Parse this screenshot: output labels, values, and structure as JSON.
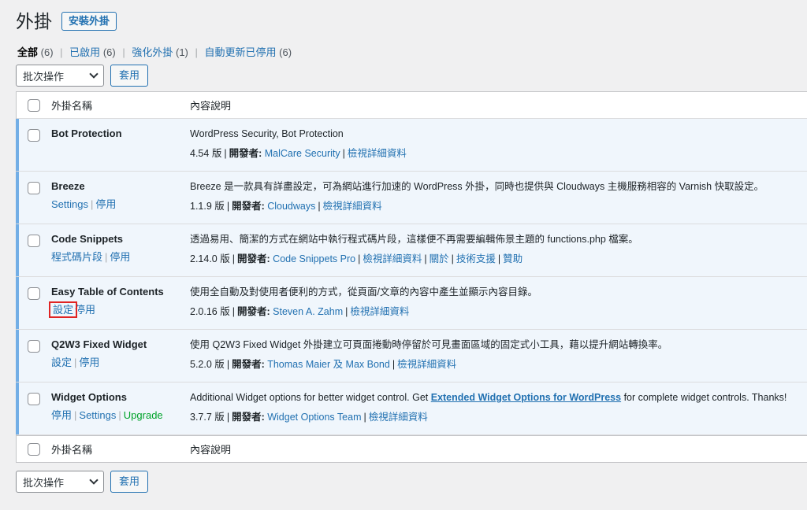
{
  "header": {
    "title": "外掛",
    "add_new": "安裝外掛"
  },
  "filters": [
    {
      "label": "全部",
      "count": "(6)",
      "current": true
    },
    {
      "label": "已啟用",
      "count": "(6)"
    },
    {
      "label": "強化外掛",
      "count": "(1)"
    },
    {
      "label": "自動更新已停用",
      "count": "(6)"
    }
  ],
  "bulk": {
    "select_value": "批次操作",
    "apply": "套用"
  },
  "columns": {
    "name": "外掛名稱",
    "desc": "內容說明"
  },
  "meta_labels": {
    "version_suffix": "版",
    "author_label": "開發者:"
  },
  "plugins": [
    {
      "name": "Bot Protection",
      "actions": [],
      "description": "WordPress Security, Bot Protection",
      "version": "4.54",
      "author": "MalCare Security",
      "links": [
        "檢視詳細資料"
      ]
    },
    {
      "name": "Breeze",
      "actions": [
        "Settings",
        "停用"
      ],
      "description": "Breeze 是一款具有詳盡設定，可為網站進行加速的 WordPress 外掛，同時也提供與 Cloudways 主機服務相容的 Varnish 快取設定。",
      "version": "1.1.9",
      "author": "Cloudways",
      "links": [
        "檢視詳細資料"
      ]
    },
    {
      "name": "Code Snippets",
      "actions": [
        "程式碼片段",
        "停用"
      ],
      "description": "透過易用、簡潔的方式在網站中執行程式碼片段，這樣便不再需要編輯佈景主題的 functions.php 檔案。",
      "version": "2.14.0",
      "author": "Code Snippets Pro",
      "links": [
        "檢視詳細資料",
        "關於",
        "技術支援",
        "贊助"
      ]
    },
    {
      "name": "Easy Table of Contents",
      "actions": [
        "設定",
        "停用"
      ],
      "description": "使用全自動及對使用者便利的方式，從頁面/文章的內容中產生並顯示內容目錄。",
      "version": "2.0.16",
      "author": "Steven A. Zahm",
      "links": [
        "檢視詳細資料"
      ]
    },
    {
      "name": "Q2W3 Fixed Widget",
      "actions": [
        "設定",
        "停用"
      ],
      "description": "使用 Q2W3 Fixed Widget 外掛建立可頁面捲動時停留於可見畫面區域的固定式小工具，藉以提升網站轉換率。",
      "version": "5.2.0",
      "author": "Thomas Maier 及 Max Bond",
      "links": [
        "檢視詳細資料"
      ]
    },
    {
      "name": "Widget Options",
      "actions": [
        "停用",
        "Settings",
        "Upgrade"
      ],
      "description_pre": "Additional Widget options for better widget control. Get ",
      "description_link": "Extended Widget Options for WordPress",
      "description_post": " for complete widget controls. Thanks!",
      "version": "3.7.7",
      "author": "Widget Options Team",
      "links": [
        "檢視詳細資料"
      ]
    }
  ]
}
